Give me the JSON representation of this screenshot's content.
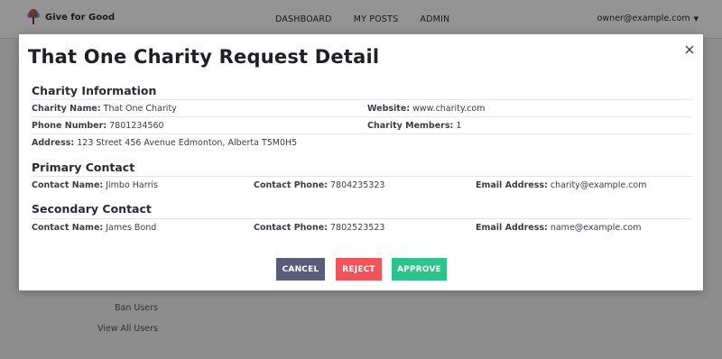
{
  "header": {
    "logo_text": "Give for Good",
    "nav": [
      "DASHBOARD",
      "MY POSTS",
      "ADMIN"
    ],
    "user_email": "owner@example.com"
  },
  "sidebar": {
    "items": [
      {
        "label": "Ban Users"
      },
      {
        "label": "View All Users"
      }
    ]
  },
  "modal": {
    "title": "That One Charity Request Detail",
    "charity": {
      "heading": "Charity Information",
      "name_label": "Charity Name:",
      "name": "That One Charity",
      "website_label": "Website:",
      "website": "www.charity.com",
      "phone_label": "Phone Number:",
      "phone": "7801234560",
      "members_label": "Charity Members:",
      "members": "1",
      "address_label": "Address:",
      "address": "123 Street 456 Avenue Edmonton, Alberta T5M0H5"
    },
    "primary": {
      "heading": "Primary Contact",
      "name_label": "Contact Name:",
      "name": "Jimbo Harris",
      "phone_label": "Contact Phone:",
      "phone": "7804235323",
      "email_label": "Email Address:",
      "email": "charity@example.com"
    },
    "secondary": {
      "heading": "Secondary Contact",
      "name_label": "Contact Name:",
      "name": "James Bond",
      "phone_label": "Contact Phone:",
      "phone": "7802523523",
      "email_label": "Email Address:",
      "email": "name@example.com"
    },
    "buttons": {
      "cancel": "CANCEL",
      "reject": "REJECT",
      "approve": "APPROVE"
    }
  },
  "colors": {
    "cancel": "#5b5c7a",
    "reject": "#f2545b",
    "approve": "#2bc48a"
  }
}
